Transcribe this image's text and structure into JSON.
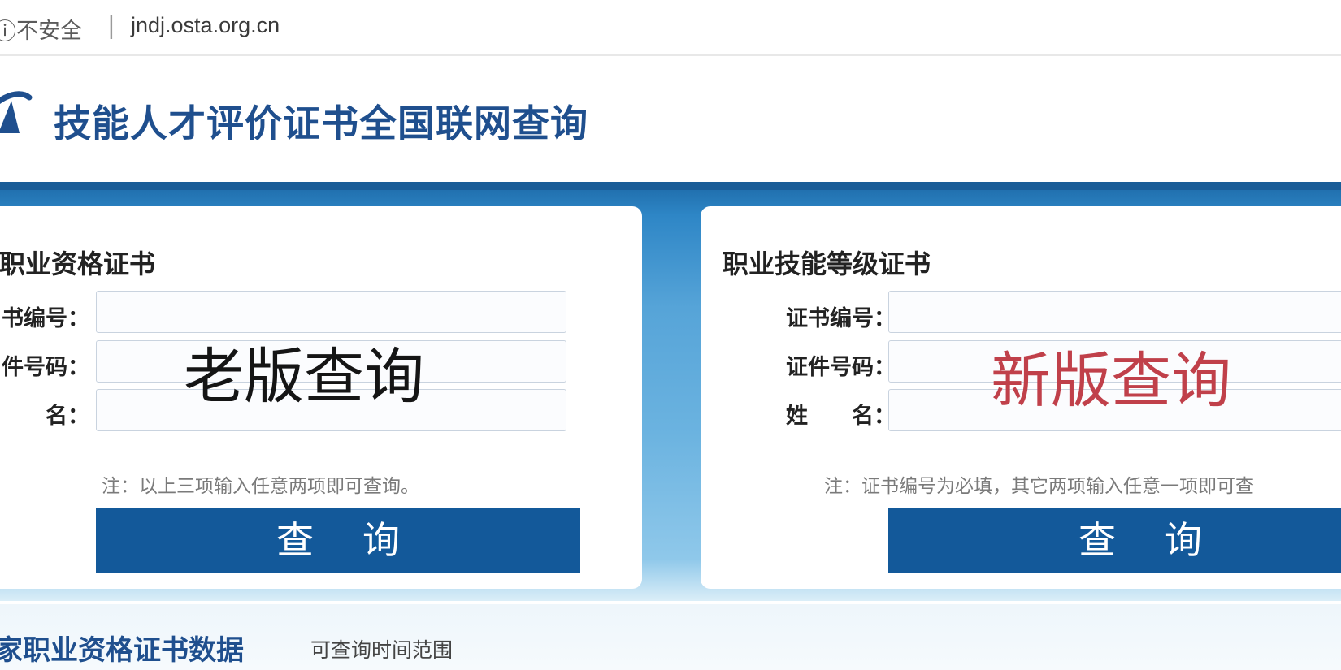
{
  "browser": {
    "security_label": "不安全",
    "separator": "|",
    "url": "jndj.osta.org.cn"
  },
  "site": {
    "title": "技能人才评价证书全国联网查询"
  },
  "panels": {
    "old": {
      "heading": "职业资格证书",
      "labels": {
        "cert_no": "书编号：",
        "id_no": "件号码：",
        "name": "名："
      },
      "note": "注：以上三项输入任意两项即可查询。",
      "button_label": "查询",
      "overlay": "老版查询"
    },
    "new": {
      "heading": "职业技能等级证书",
      "labels": {
        "cert_no": "证书编号：",
        "id_no": "证件号码：",
        "name": "姓　　名："
      },
      "note": "注：证书编号为必填，其它两项输入任意一项即可查",
      "button_label": "查询",
      "overlay": "新版查询"
    }
  },
  "footer": {
    "title": "家职业资格证书数据",
    "subtitle": "可查询时间范围"
  },
  "colors": {
    "brand_blue": "#1f4f8e",
    "button_blue": "#13599a",
    "overlay_red": "#c0404a"
  }
}
